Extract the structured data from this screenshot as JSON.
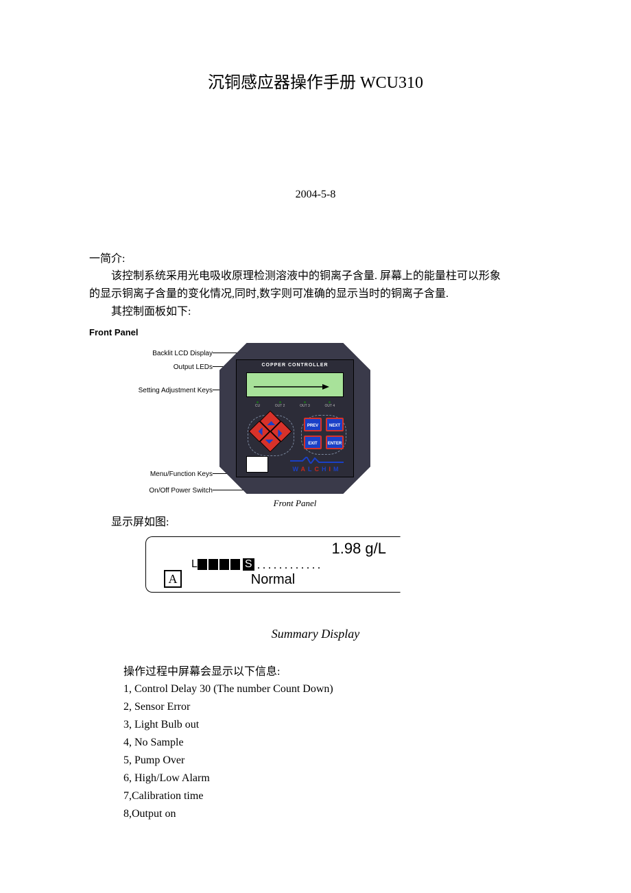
{
  "title": "沉铜感应器操作手册 WCU310",
  "date": "2004-5-8",
  "intro_heading": "一简介:",
  "intro_p1": "该控制系统采用光电吸收原理检测溶液中的铜离子含量. 屏幕上的能量柱可以形象",
  "intro_p2": "的显示铜离子含量的变化情况,同时,数字则可准确的显示当时的铜离子含量.",
  "intro_p3": "其控制面板如下:",
  "front_panel": {
    "heading": "Front Panel",
    "labels": {
      "lcd": "Backlit LCD Display",
      "leds": "Output LEDs",
      "arrows": "Setting Adjustment Keys",
      "menu": "Menu/Function Keys",
      "switch": "On/Off Power Switch"
    },
    "panel_title": "COPPER CONTROLLER",
    "led_names": [
      "CU",
      "OUT 2",
      "OUT 3",
      "OUT 4"
    ],
    "menu_keys": {
      "prev": "PREV",
      "next": "NEXT",
      "exit": "EXIT",
      "enter": "ENTER"
    },
    "brand": "WALCHIM",
    "caption": "Front Panel"
  },
  "display": {
    "intro": "显示屏如图:",
    "value": "1.98 g/L",
    "bar_low": "L",
    "bar_set": "S",
    "indicator": "A",
    "status": "Normal",
    "caption": "Summary Display"
  },
  "messages": {
    "intro": "操作过程中屏幕会显示以下信息:",
    "items": [
      "1, Control Delay 30 (The number Count Down)",
      "2, Sensor Error",
      "3, Light Bulb out",
      "4, No Sample",
      "5, Pump Over",
      "6, High/Low Alarm",
      "7,Calibration time",
      "8,Output on"
    ]
  }
}
